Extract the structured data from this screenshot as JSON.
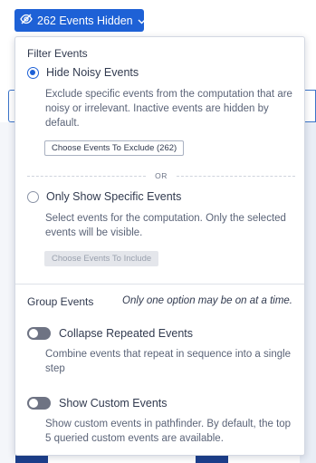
{
  "trigger": {
    "label": "262 Events Hidden",
    "icon": "eye-slash-icon",
    "chevron": "chevron-down-icon"
  },
  "filter": {
    "title": "Filter Events",
    "hide_noisy": {
      "label": "Hide Noisy Events",
      "checked": true,
      "description": "Exclude specific events from the computation that are noisy or irrelevant. Inactive events are hidden by default.",
      "button": "Choose Events To Exclude (262)"
    },
    "or_label": "OR",
    "only_specific": {
      "label": "Only Show Specific Events",
      "checked": false,
      "description": "Select events for the computation. Only the selected events will be visible.",
      "button": "Choose Events To Include"
    }
  },
  "group": {
    "title": "Group Events",
    "note": "Only one option may be on at a time.",
    "collapse": {
      "label": "Collapse Repeated Events",
      "on": false,
      "description": "Combine events that repeat in sequence into a single step"
    },
    "custom": {
      "label": "Show Custom Events",
      "on": false,
      "description": "Show custom events in pathfinder. By default, the top 5 queried custom events are available."
    }
  },
  "colors": {
    "accent": "#1e61d6",
    "toggle_off": "#6e7383"
  }
}
